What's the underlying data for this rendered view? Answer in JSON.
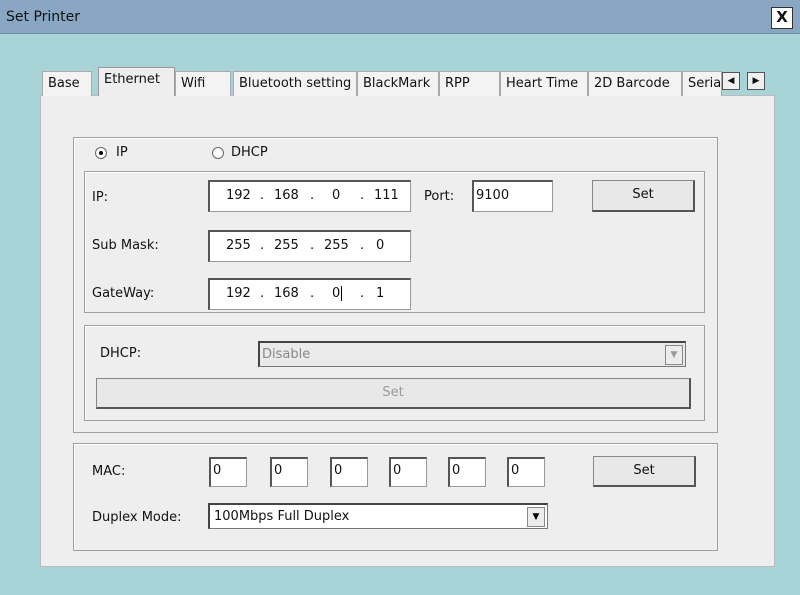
{
  "window": {
    "title": "Set Printer",
    "close_label": "X"
  },
  "tabs": [
    {
      "label": "Base"
    },
    {
      "label": "Ethernet",
      "active": true
    },
    {
      "label": "Wifi"
    },
    {
      "label": "Bluetooth setting"
    },
    {
      "label": "BlackMark"
    },
    {
      "label": "RPP"
    },
    {
      "label": "Heart Time"
    },
    {
      "label": "2D Barcode"
    },
    {
      "label": "Serial"
    }
  ],
  "tab_scroll": {
    "left": "◀",
    "right": "▶"
  },
  "mode": {
    "ip_label": "IP",
    "dhcp_label": "DHCP",
    "selected": "IP"
  },
  "static": {
    "ip_label": "IP:",
    "ip": [
      "192",
      "168",
      "0",
      "111"
    ],
    "port_label": "Port:",
    "port": "9100",
    "set_label": "Set",
    "mask_label": "Sub Mask:",
    "mask": [
      "255",
      "255",
      "255",
      "0"
    ],
    "gateway_label": "GateWay:",
    "gateway": [
      "192",
      "168",
      "0",
      "1"
    ],
    "dot": "."
  },
  "dhcp": {
    "label": "DHCP:",
    "value": "Disable",
    "set_label": "Set",
    "disabled": true
  },
  "mac": {
    "label": "MAC:",
    "values": [
      "0",
      "0",
      "0",
      "0",
      "0",
      "0"
    ],
    "set_label": "Set"
  },
  "duplex": {
    "label": "Duplex Mode:",
    "value": "100Mbps Full Duplex"
  },
  "colors": {
    "titlebar": "#89a7c3",
    "background": "#a8d4d8",
    "panel": "#eeeeee"
  }
}
